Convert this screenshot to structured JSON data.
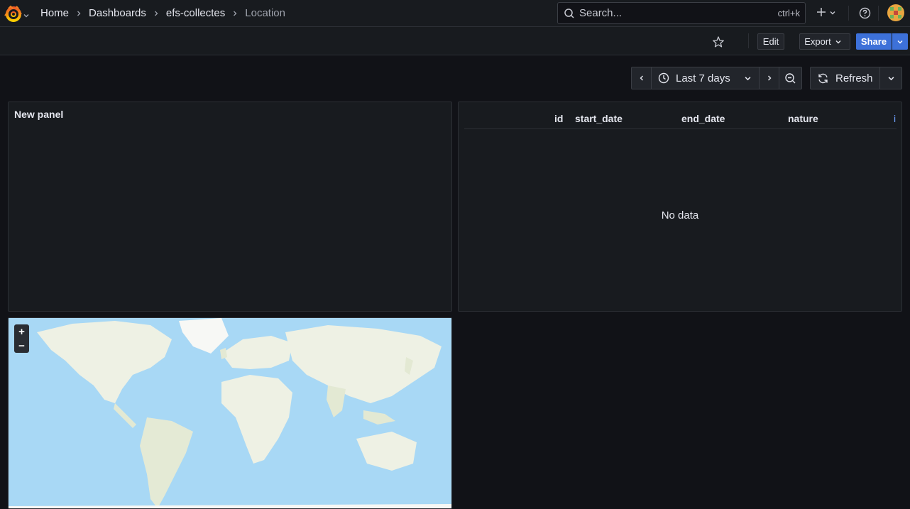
{
  "topbar": {
    "breadcrumbs": [
      {
        "label": "Home"
      },
      {
        "label": "Dashboards"
      },
      {
        "label": "efs-collectes"
      },
      {
        "label": "Location"
      }
    ],
    "search": {
      "placeholder": "Search...",
      "shortcut": "ctrl+k"
    }
  },
  "toolbar": {
    "edit_label": "Edit",
    "export_label": "Export",
    "share_label": "Share"
  },
  "time_controls": {
    "range_label": "Last 7 days",
    "refresh_label": "Refresh"
  },
  "panels": {
    "new_panel": {
      "title": "New panel"
    },
    "table": {
      "columns": [
        "id",
        "start_date",
        "end_date",
        "nature",
        "i"
      ],
      "empty_text": "No data"
    },
    "map": {
      "zoom_in": "+",
      "zoom_out": "−"
    }
  },
  "colors": {
    "background": "#111217",
    "panel": "#181b1f",
    "accent_primary": "#3d71d9",
    "logo_orange": "#f58220",
    "ocean": "#a8d8f5",
    "land": "#eef1e4"
  },
  "icons": [
    "grafana-logo-icon",
    "search-icon",
    "plus-icon",
    "help-icon",
    "star-icon",
    "clock-icon",
    "zoom-out-icon",
    "refresh-icon"
  ]
}
